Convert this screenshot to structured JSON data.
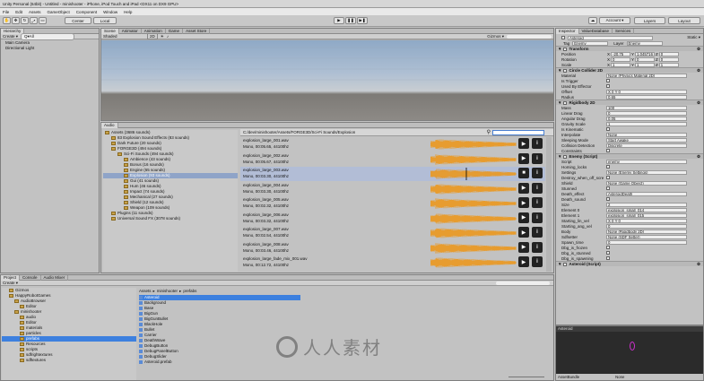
{
  "window": {
    "title": "Unity Personal (64bit) - Untitled - minishooter - iPhone, iPod Touch and iPad <DX11 on DX9 GPU>"
  },
  "menu": [
    "File",
    "Edit",
    "Assets",
    "GameObject",
    "Component",
    "Window",
    "Help"
  ],
  "toolbar": {
    "center": "Center",
    "local": "Local",
    "account": "Account ▾",
    "layers": "Layers",
    "layout": "Layout"
  },
  "hierarchy": {
    "tab": "Hierarchy",
    "create": "Create ▾",
    "search": "Q▾All",
    "items": [
      "Main Camera",
      "Directional Light"
    ]
  },
  "scene": {
    "tabs": [
      "Scene",
      "Animator",
      "Animation",
      "Game",
      "Asset Store"
    ],
    "shaded": "Shaded",
    "twoD": "2D",
    "gizmos": "Gizmos ▾"
  },
  "audio": {
    "tab": "Audio",
    "path": "C:/dev/minishooter/Assets/FORGE3D/Sci-Fi Sounds/Explosion",
    "tree": [
      {
        "l": "Assets (3686 sounds)",
        "i": 0
      },
      {
        "l": "83 Explosion Sound Effects (83 sounds)",
        "i": 1
      },
      {
        "l": "Dark Future (20 sounds)",
        "i": 1
      },
      {
        "l": "FORGE3D (494 sounds)",
        "i": 1
      },
      {
        "l": "Sci-Fi Sounds (494 sounds)",
        "i": 2
      },
      {
        "l": "Ambience (43 sounds)",
        "i": 3
      },
      {
        "l": "Bonus (16 sounds)",
        "i": 3
      },
      {
        "l": "Engine (65 sounds)",
        "i": 3
      },
      {
        "l": "Explosion (93 sounds)",
        "i": 3,
        "sel": true
      },
      {
        "l": "Gui (41 sounds)",
        "i": 3
      },
      {
        "l": "Hum (46 sounds)",
        "i": 3
      },
      {
        "l": "Impact (74 sounds)",
        "i": 3
      },
      {
        "l": "Mechanical (27 sounds)",
        "i": 3
      },
      {
        "l": "Shield (12 sounds)",
        "i": 3
      },
      {
        "l": "Weapon (109 sounds)",
        "i": 3
      },
      {
        "l": "Plugins (11 sounds)",
        "i": 1
      },
      {
        "l": "Universal Sound FX (3078 sounds)",
        "i": 1
      }
    ],
    "files": [
      {
        "n": "explosion_large_001.wav",
        "m": "Mono, 00:05.65, 44100hz"
      },
      {
        "n": "explosion_large_002.wav",
        "m": "Mono, 00:05.67, 44100hz"
      },
      {
        "n": "explosion_large_003.wav",
        "m": "Mono, 00:03.30, 44100hz"
      },
      {
        "n": "explosion_large_004.wav",
        "m": "Mono, 00:03.30, 44100hz"
      },
      {
        "n": "explosion_large_005.wav",
        "m": "Mono, 00:02.32, 44100hz"
      },
      {
        "n": "explosion_large_006.wav",
        "m": "Mono, 00:03.32, 44100hz"
      },
      {
        "n": "explosion_large_007.wav",
        "m": "Mono, 00:02.54, 44100hz"
      },
      {
        "n": "explosion_large_008.wav",
        "m": "Mono, 00:03.46, 44100hz"
      },
      {
        "n": "explosion_large_fade_mix_001.wav",
        "m": "Mono, 00:12.72, 44100hz"
      }
    ]
  },
  "project": {
    "tabs": [
      "Project",
      "Console",
      "Audio Mixer"
    ],
    "create": "Create ▾",
    "tree": [
      {
        "l": "Gizmos",
        "i": 1
      },
      {
        "l": "HappyRobotGames",
        "i": 1
      },
      {
        "l": "AudioBrowser",
        "i": 2
      },
      {
        "l": "Editor",
        "i": 3
      },
      {
        "l": "minishooter",
        "i": 2
      },
      {
        "l": "audio",
        "i": 3
      },
      {
        "l": "Editor",
        "i": 3
      },
      {
        "l": "materials",
        "i": 3
      },
      {
        "l": "particles",
        "i": 3
      },
      {
        "l": "prefabs",
        "i": 3,
        "sel": true
      },
      {
        "l": "Resources",
        "i": 3
      },
      {
        "l": "scripts",
        "i": 3
      },
      {
        "l": "sdfrightextures",
        "i": 3
      },
      {
        "l": "sdftextures",
        "i": 3
      }
    ],
    "breadcrumb": [
      "Assets",
      "minishooter",
      "prefabs"
    ],
    "assets": [
      "Asteroid",
      "Background",
      "Base",
      "BigGun",
      "BigGunBullet",
      "BlackHole",
      "Bullet",
      "Carrier",
      "DeathWave",
      "DebugButton",
      "DebugPanelButton",
      "DebugSlider",
      "Asteroid.prefab"
    ]
  },
  "inspector": {
    "tabs": [
      "Inspector",
      "ValueDatabase",
      "Services"
    ],
    "name": "Asteroid",
    "static": "Static ▾",
    "tag": "Enemy",
    "layer": "Enemy",
    "transform": {
      "title": "Transform",
      "rows": [
        [
          "Position",
          "-20.75",
          "1.045716",
          "0"
        ],
        [
          "Rotation",
          "0",
          "0",
          "0"
        ],
        [
          "Scale",
          "1",
          "1",
          "1"
        ]
      ]
    },
    "circle": {
      "title": "Circle Collider 2D",
      "rows": [
        [
          "Material",
          "None (Physics Material 2D)"
        ],
        [
          "Is Trigger",
          ""
        ],
        [
          "Used By Effector",
          ""
        ],
        [
          "Offset",
          "X 0   Y 0"
        ],
        [
          "Radius",
          "0.65"
        ]
      ]
    },
    "rigidbody": {
      "title": "Rigidbody 2D",
      "rows": [
        [
          "Mass",
          "100"
        ],
        [
          "Linear Drag",
          "0"
        ],
        [
          "Angular Drag",
          "0.05"
        ],
        [
          "Gravity Scale",
          "1"
        ],
        [
          "Is Kinematic",
          ""
        ],
        [
          "Interpolate",
          "None"
        ],
        [
          "Sleeping Mode",
          "Start Awake"
        ],
        [
          "Collision Detection",
          "Discrete"
        ],
        [
          "Constraints",
          ""
        ]
      ]
    },
    "enemy": {
      "title": "Enemy (Script)",
      "rows": [
        [
          "Script",
          "enemy"
        ],
        [
          "Homing_locks",
          ""
        ],
        [
          "Settings",
          "None (Enemy Settings)"
        ],
        [
          "Destroy_when_off_scre",
          ""
        ],
        [
          "Shield",
          "None (Game Object)"
        ],
        [
          "Stunned",
          ""
        ],
        [
          "Death_effect",
          "AsteroidDeath"
        ],
        [
          "Death_sound",
          ""
        ],
        [
          "Size",
          "2"
        ],
        [
          "Element 0",
          "explosion_small_014"
        ],
        [
          "Element 1",
          "explosion_small_015"
        ],
        [
          "Starting_lin_vel",
          "X 0   Y 0"
        ],
        [
          "Starting_ang_vel",
          "0"
        ],
        [
          "Body",
          "None (Rigidbody 2D)"
        ],
        [
          "Sdfsetter",
          "None (SDF Setter)"
        ],
        [
          "Spawn_time",
          "0"
        ],
        [
          "Dbg_is_frozen",
          ""
        ],
        [
          "Dbg_is_stunned",
          ""
        ],
        [
          "Dbg_is_spawning",
          ""
        ]
      ]
    },
    "asteroid": {
      "title": "Asteroid (Script)"
    },
    "preview": {
      "title": "Asteroid",
      "bundle": "AssetBundle",
      "none": "None"
    }
  },
  "watermark": "人人素材"
}
